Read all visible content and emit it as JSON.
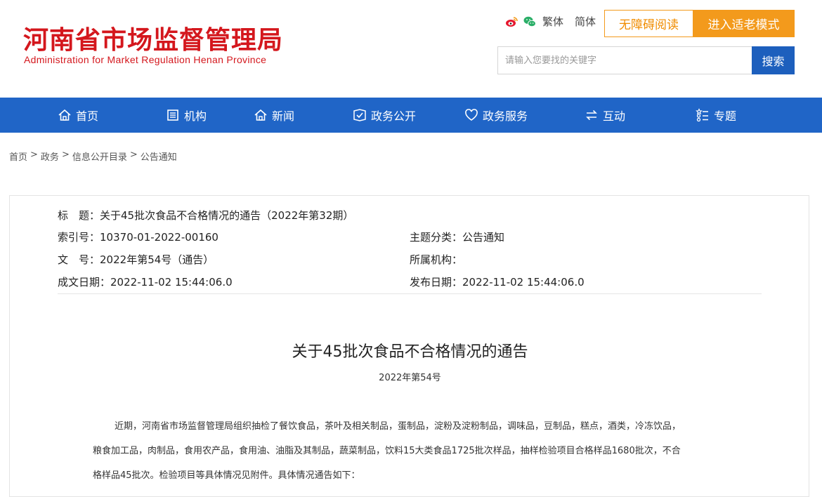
{
  "header": {
    "logo_cn": "河南省市场监督管理局",
    "logo_en": "Administration for Market Regulation Henan Province",
    "traditional_label": "繁体",
    "simplified_label": "简体",
    "accessible_label": "无障碍阅读",
    "elder_mode_label": "进入适老模式",
    "search_placeholder": "请输入您要找的关键字",
    "search_button": "搜索"
  },
  "nav": {
    "items": [
      {
        "label": "首页",
        "icon": "home-icon"
      },
      {
        "label": "机构",
        "icon": "org-icon"
      },
      {
        "label": "新闻",
        "icon": "news-icon"
      },
      {
        "label": "政务公开",
        "icon": "gov-open-icon"
      },
      {
        "label": "政务服务",
        "icon": "heart-icon"
      },
      {
        "label": "互动",
        "icon": "exchange-icon"
      },
      {
        "label": "专题",
        "icon": "topic-icon"
      }
    ]
  },
  "breadcrumb": {
    "items": [
      "首页",
      "政务",
      "信息公开目录",
      "公告通知"
    ],
    "separator": ">"
  },
  "meta": {
    "title_label": "标　题：",
    "title_value": "关于45批次食品不合格情况的通告（2022年第32期）",
    "index_label": "索引号：",
    "index_value": "10370-01-2022-00160",
    "topic_label": "主题分类：",
    "topic_value": "公告通知",
    "docno_label": "文　号：",
    "docno_value": "2022年第54号（通告）",
    "org_label": "所属机构：",
    "org_value": "",
    "created_label": "成文日期：",
    "created_value": "2022-11-02 15:44:06.0",
    "published_label": "发布日期：",
    "published_value": "2022-11-02 15:44:06.0"
  },
  "article": {
    "title": "关于45批次食品不合格情况的通告",
    "doc_number": "2022年第54号",
    "paragraph1_line1": "近期，河南省市场监督管理局组织抽检了餐饮食品，茶叶及相关制品，蛋制品，淀粉及淀粉制品，调味品，豆制品，糕点，酒类，冷冻饮品，",
    "paragraph1_line2": "粮食加工品，肉制品，食用农产品，食用油、油脂及其制品，蔬菜制品，饮料15大类食品1725批次样品，抽样检验项目合格样品1680批次，不合",
    "paragraph1_line3": "格样品45批次。检验项目等具体情况见附件。具体情况通告如下："
  },
  "colors": {
    "brand_red": "#d4171d",
    "nav_blue": "#2065c7",
    "accent_orange": "#f39a1c"
  }
}
